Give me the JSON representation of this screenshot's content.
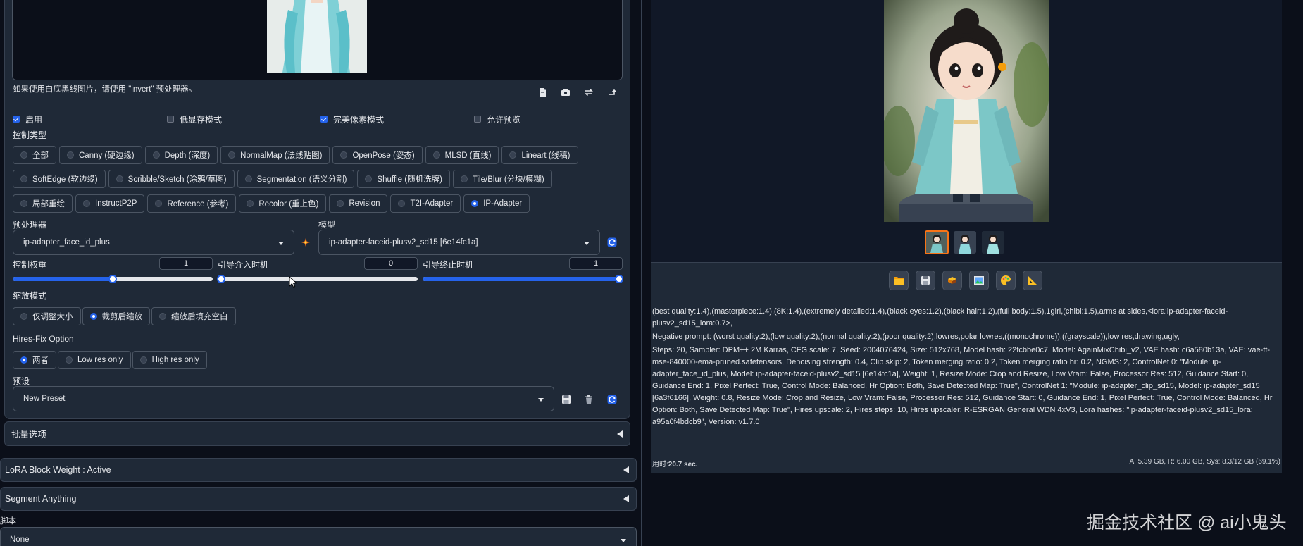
{
  "controlnet": {
    "hint": "如果使用白底黑线图片，请使用 \"invert\" 预处理器。",
    "checkboxes": [
      {
        "label": "启用",
        "checked": true
      },
      {
        "label": "低显存模式",
        "checked": false
      },
      {
        "label": "完美像素模式",
        "checked": true
      },
      {
        "label": "允许预览",
        "checked": false
      }
    ],
    "control_type_label": "控制类型",
    "control_types_row1": [
      "全部",
      "Canny (硬边缘)",
      "Depth (深度)",
      "NormalMap (法线贴图)",
      "OpenPose (姿态)",
      "MLSD (直线)",
      "Lineart (线稿)"
    ],
    "control_types_row2": [
      "SoftEdge (软边缘)",
      "Scribble/Sketch (涂鸦/草图)",
      "Segmentation (语义分割)",
      "Shuffle (随机洗牌)",
      "Tile/Blur (分块/模糊)"
    ],
    "control_types_row3": [
      "局部重绘",
      "InstructP2P",
      "Reference (参考)",
      "Recolor (重上色)",
      "Revision",
      "T2I-Adapter",
      "IP-Adapter"
    ],
    "selected_control_type": "IP-Adapter",
    "preprocessor_label": "预处理器",
    "preprocessor_value": "ip-adapter_face_id_plus",
    "model_label": "模型",
    "model_value": "ip-adapter-faceid-plusv2_sd15 [6e14fc1a]",
    "weight_label": "控制权重",
    "weight_value": "1",
    "weight_fraction": 0.5,
    "start_label": "引导介入时机",
    "start_value": "0",
    "start_fraction": 0.0,
    "end_label": "引导终止时机",
    "end_value": "1",
    "end_fraction": 1.0,
    "resize_label": "缩放模式",
    "resize_modes": [
      "仅调整大小",
      "裁剪后缩放",
      "缩放后填充空白"
    ],
    "resize_selected": "裁剪后缩放",
    "hires_label": "Hires-Fix Option",
    "hires_options": [
      "两者",
      "Low res only",
      "High res only"
    ],
    "hires_selected": "两者",
    "preset_label": "预设",
    "preset_value": "New Preset"
  },
  "accordions": {
    "batch": "批量选项",
    "lora_block": "LoRA Block Weight : Active",
    "segment": "Segment Anything"
  },
  "script": {
    "label": "脚本",
    "value": "None"
  },
  "output": {
    "thumbnails_count": 3,
    "prompt": "(best quality:1.4),(masterpiece:1.4),(8K:1.4),(extremely detailed:1.4),(black eyes:1.2),(black hair:1.2),(full body:1.5),1girl,(chibi:1.5),arms at sides,<lora:ip-adapter-faceid-plusv2_sd15_lora:0.7>,",
    "negative": "Negative prompt: (worst quality:2),(low quality:2),(normal quality:2),(poor quality:2),lowres,polar lowres,((monochrome)),((grayscale)),low res,drawing,ugly,",
    "params": "Steps: 20, Sampler: DPM++ 2M Karras, CFG scale: 7, Seed: 2004076424, Size: 512x768, Model hash: 22fcbbe0c7, Model: AgainMixChibi_v2, VAE hash: c6a580b13a, VAE: vae-ft-mse-840000-ema-pruned.safetensors, Denoising strength: 0.4, Clip skip: 2, Token merging ratio: 0.2, Token merging ratio hr: 0.2, NGMS: 2, ControlNet 0: \"Module: ip-adapter_face_id_plus, Model: ip-adapter-faceid-plusv2_sd15 [6e14fc1a], Weight: 1, Resize Mode: Crop and Resize, Low Vram: False, Processor Res: 512, Guidance Start: 0, Guidance End: 1, Pixel Perfect: True, Control Mode: Balanced, Hr Option: Both, Save Detected Map: True\", ControlNet 1: \"Module: ip-adapter_clip_sd15, Model: ip-adapter_sd15 [6a3f6166], Weight: 0.8, Resize Mode: Crop and Resize, Low Vram: False, Processor Res: 512, Guidance Start: 0, Guidance End: 1, Pixel Perfect: True, Control Mode: Balanced, Hr Option: Both, Save Detected Map: True\", Hires upscale: 2, Hires steps: 10, Hires upscaler: R-ESRGAN General WDN 4xV3, Lora hashes: \"ip-adapter-faceid-plusv2_sd15_lora: a95a0f4bdcb9\", Version: v1.7.0",
    "time_label": "用时:",
    "time_value": "20.7 sec.",
    "vram": "A: 5.39 GB, R: 6.00 GB, Sys: 8.3/12 GB (69.1%)"
  },
  "watermark": "掘金技术社区 @ ai小鬼头",
  "colors": {
    "accent": "#2563eb",
    "background": "#0b0f19",
    "panel": "#1f2937",
    "thumb_selected": "#f97316"
  }
}
